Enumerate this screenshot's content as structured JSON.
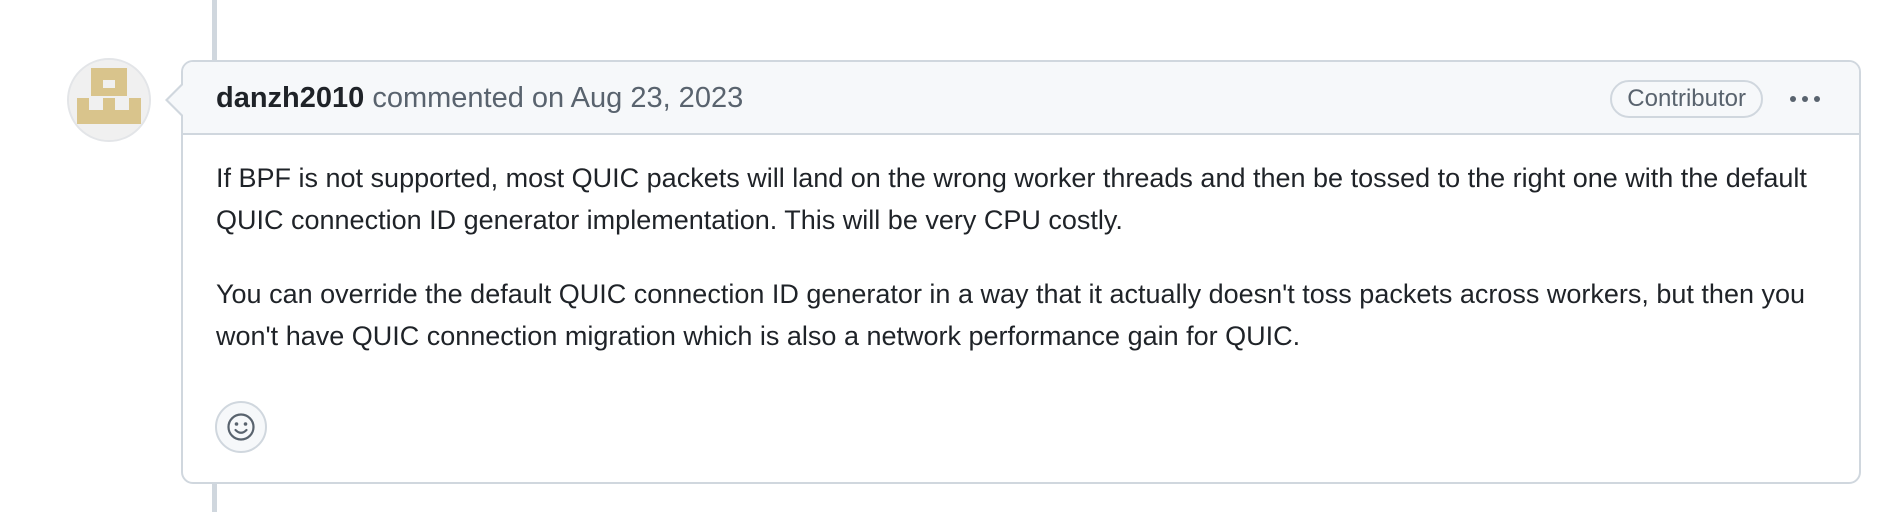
{
  "comment": {
    "author": "danzh2010",
    "action": "commented on",
    "date": "Aug 23, 2023",
    "role_badge": "Contributor",
    "body_paragraphs": [
      "If BPF is not supported, most QUIC packets will land on the wrong worker threads and then be tossed to the right one with the default QUIC connection ID generator implementation. This will be very CPU costly.",
      "You can override the default QUIC connection ID generator in a way that it actually doesn't toss packets across workers, but then you won't have QUIC connection migration which is also a network performance gain for QUIC."
    ]
  },
  "icons": {
    "menu": "kebab-horizontal-icon",
    "reaction": "smiley-icon",
    "avatar": "identicon"
  },
  "colors": {
    "border": "#d0d7de",
    "header_bg": "#f6f8fa",
    "muted_text": "#59636e",
    "text": "#1f2328",
    "identicon": "#d9c48c"
  }
}
